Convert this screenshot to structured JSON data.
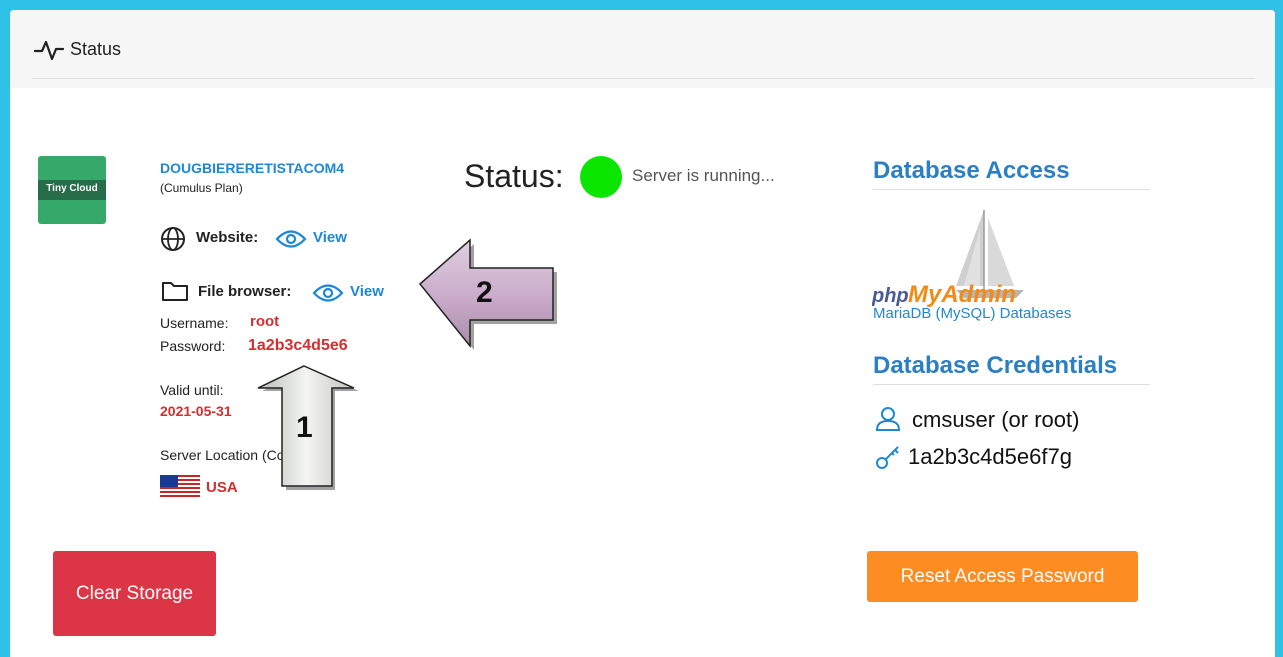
{
  "header": {
    "title": "Status",
    "icon": "pulse-icon"
  },
  "account": {
    "logo_text": "Tiny Cloud",
    "name": "DOUGBIERERETISTACOM4",
    "plan": "(Cumulus Plan)"
  },
  "website": {
    "label": "Website:",
    "link": "View"
  },
  "file_browser": {
    "label": "File browser:",
    "link": "View",
    "username_label": "Username:",
    "username": "root",
    "password_label": "Password:",
    "password": "1a2b3c4d5e6"
  },
  "validity": {
    "label": "Valid until:",
    "date": "2021-05-31"
  },
  "location": {
    "label": "Server Location (Country):",
    "country": "USA"
  },
  "status": {
    "label": "Status:",
    "message": "Server is running...",
    "indicator_color": "#0be600"
  },
  "database_access": {
    "title": "Database Access",
    "pma_brand_php": "php",
    "pma_brand_myadmin": "MyAdmin",
    "caption": "MariaDB (MySQL) Databases"
  },
  "database_credentials": {
    "title": "Database Credentials",
    "user": "cmsuser (or root)",
    "password": "1a2b3c4d5e6f7g"
  },
  "buttons": {
    "clear_storage": "Clear Storage",
    "reset_password": "Reset Access Password"
  },
  "annotations": {
    "arrow_up_label": "1",
    "arrow_left_label": "2"
  },
  "colors": {
    "frame": "#2ec3e6",
    "link": "#1e88d6",
    "accent_red": "#d32f2f",
    "section_blue": "#2b7fc2",
    "btn_red": "#dc3545",
    "btn_orange": "#fd8c23"
  }
}
